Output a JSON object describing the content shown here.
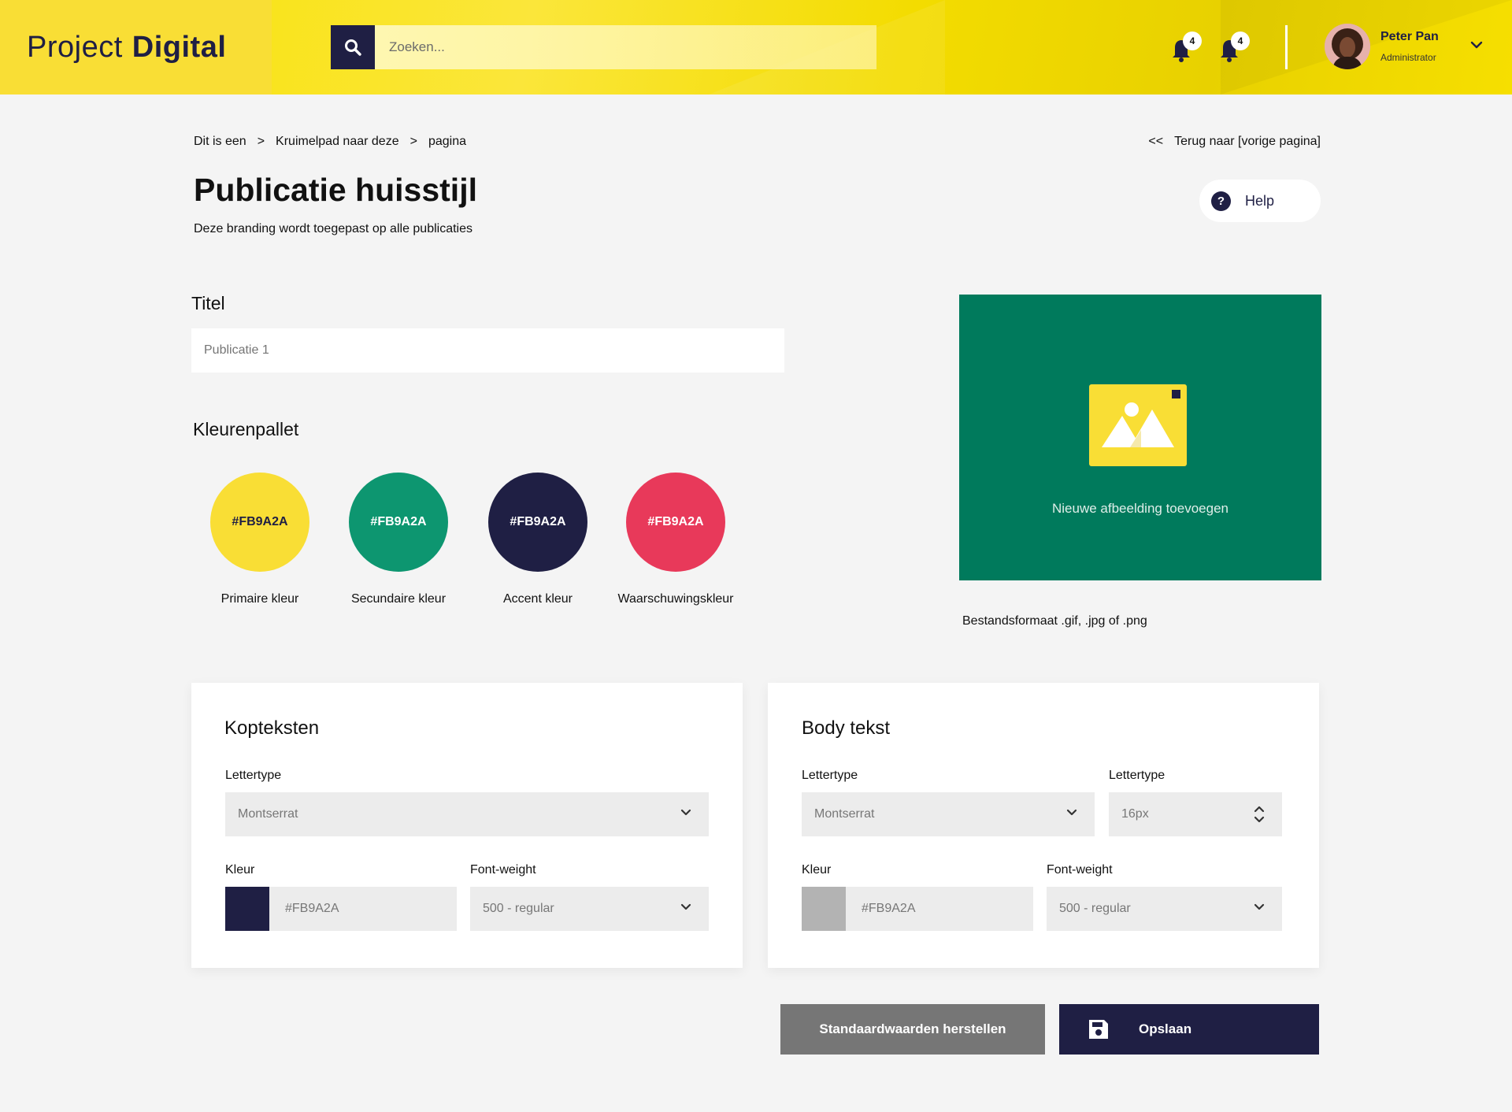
{
  "header": {
    "logo_light": "Project",
    "logo_bold": "Digital",
    "search_placeholder": "Zoeken...",
    "notifications": [
      {
        "count": "4"
      },
      {
        "count": "4"
      }
    ],
    "user": {
      "name": "Peter Pan",
      "role": "Administrator"
    }
  },
  "breadcrumb": {
    "items": [
      "Dit is een",
      "Kruimelpad naar deze",
      "pagina"
    ],
    "separator": ">"
  },
  "back": {
    "arrow": "<<",
    "label": "Terug naar [vorige pagina]"
  },
  "page": {
    "title": "Publicatie huisstijl",
    "subtitle": "Deze branding wordt toegepast op alle publicaties",
    "help_label": "Help",
    "help_icon": "?"
  },
  "title_section": {
    "label": "Titel",
    "placeholder": "Publicatie 1"
  },
  "palette": {
    "label": "Kleurenpallet",
    "colors": [
      {
        "hex_label": "#FB9A2A",
        "name": "Primaire kleur",
        "fill": "#f9de35",
        "text_color": "#1f1f44"
      },
      {
        "hex_label": "#FB9A2A",
        "name": "Secundaire kleur",
        "fill": "#0d9670",
        "text_color": "#ffffff"
      },
      {
        "hex_label": "#FB9A2A",
        "name": "Accent kleur",
        "fill": "#1f1f44",
        "text_color": "#ffffff"
      },
      {
        "hex_label": "#FB9A2A",
        "name": "Waarschuwingskleur",
        "fill": "#e8395a",
        "text_color": "#ffffff"
      }
    ]
  },
  "image_upload": {
    "label": "Nieuwe afbeelding toevoegen",
    "hint": "Bestandsformaat .gif, .jpg of .png",
    "background": "#007a5c",
    "icon": "image-icon"
  },
  "headings_card": {
    "title": "Kopteksten",
    "font_label": "Lettertype",
    "font_value": "Montserrat",
    "color_label": "Kleur",
    "color_value": "#FB9A2A",
    "color_chip": "#1f1f44",
    "weight_label": "Font-weight",
    "weight_value": "500 - regular"
  },
  "body_card": {
    "title": "Body tekst",
    "font_label": "Lettertype",
    "font_value": "Montserrat",
    "size_label": "Lettertype",
    "size_value": "16px",
    "color_label": "Kleur",
    "color_value": "#FB9A2A",
    "color_chip": "#b3b3b3",
    "weight_label": "Font-weight",
    "weight_value": "500 - regular"
  },
  "actions": {
    "reset_label": "Standaardwaarden herstellen",
    "save_label": "Opslaan"
  },
  "colors": {
    "brand_yellow": "#f9de35",
    "navy": "#1f1f44",
    "green": "#007a5c",
    "grey_button": "#767676"
  }
}
